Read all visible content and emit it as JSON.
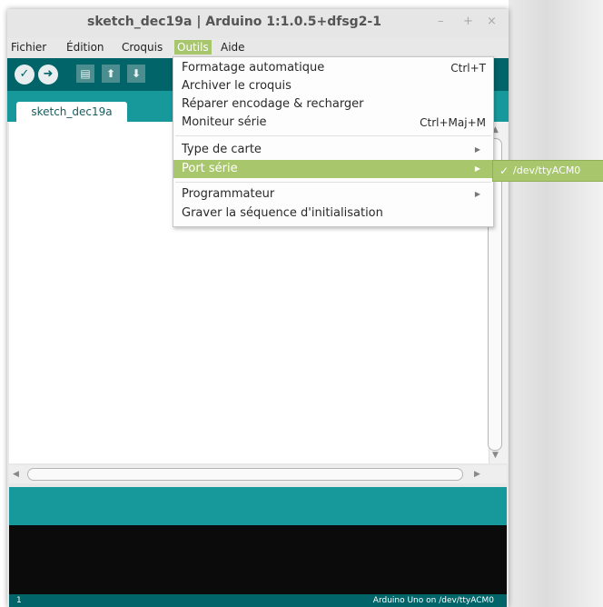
{
  "window": {
    "title": "sketch_dec19a | Arduino 1:1.0.5+dfsg2-1",
    "controls": [
      "–",
      "+",
      "×"
    ]
  },
  "menubar": [
    {
      "label": "Fichier",
      "active": false
    },
    {
      "label": "Édition",
      "active": false
    },
    {
      "label": "Croquis",
      "active": false
    },
    {
      "label": "Outils",
      "active": true
    },
    {
      "label": "Aide",
      "active": false
    }
  ],
  "toolbar": {
    "buttons": [
      {
        "name": "verify-icon",
        "glyph": "✓"
      },
      {
        "name": "upload-icon",
        "glyph": "➜"
      },
      {
        "name": "new-file-icon",
        "glyph": "▤"
      },
      {
        "name": "open-icon",
        "glyph": "⬆"
      },
      {
        "name": "save-icon",
        "glyph": "⬇"
      }
    ]
  },
  "tab": {
    "label": "sketch_dec19a"
  },
  "tools_menu": {
    "items": [
      {
        "label": "Formatage automatique",
        "shortcut": "Ctrl+T"
      },
      {
        "label": "Archiver le croquis",
        "shortcut": ""
      },
      {
        "label": "Réparer encodage & recharger",
        "shortcut": ""
      },
      {
        "label": "Moniteur série",
        "shortcut": "Ctrl+Maj+M"
      },
      {
        "label": "Type de carte",
        "shortcut": "",
        "submenu": true
      },
      {
        "label": "Port série",
        "shortcut": "",
        "submenu": true,
        "highlighted": true
      },
      {
        "label": "Programmateur",
        "shortcut": "",
        "submenu": true
      },
      {
        "label": "Graver la séquence d'initialisation",
        "shortcut": ""
      }
    ]
  },
  "serial_port_submenu": {
    "items": [
      {
        "label": "/dev/ttyACM0",
        "checked": true
      }
    ]
  },
  "status": {
    "line": "1",
    "board": "Arduino Uno on /dev/ttyACM0"
  },
  "colors": {
    "accent": "#a8c66c",
    "toolbar": "#006468",
    "tabbar": "#17999c",
    "console": "#0b0b0b"
  }
}
